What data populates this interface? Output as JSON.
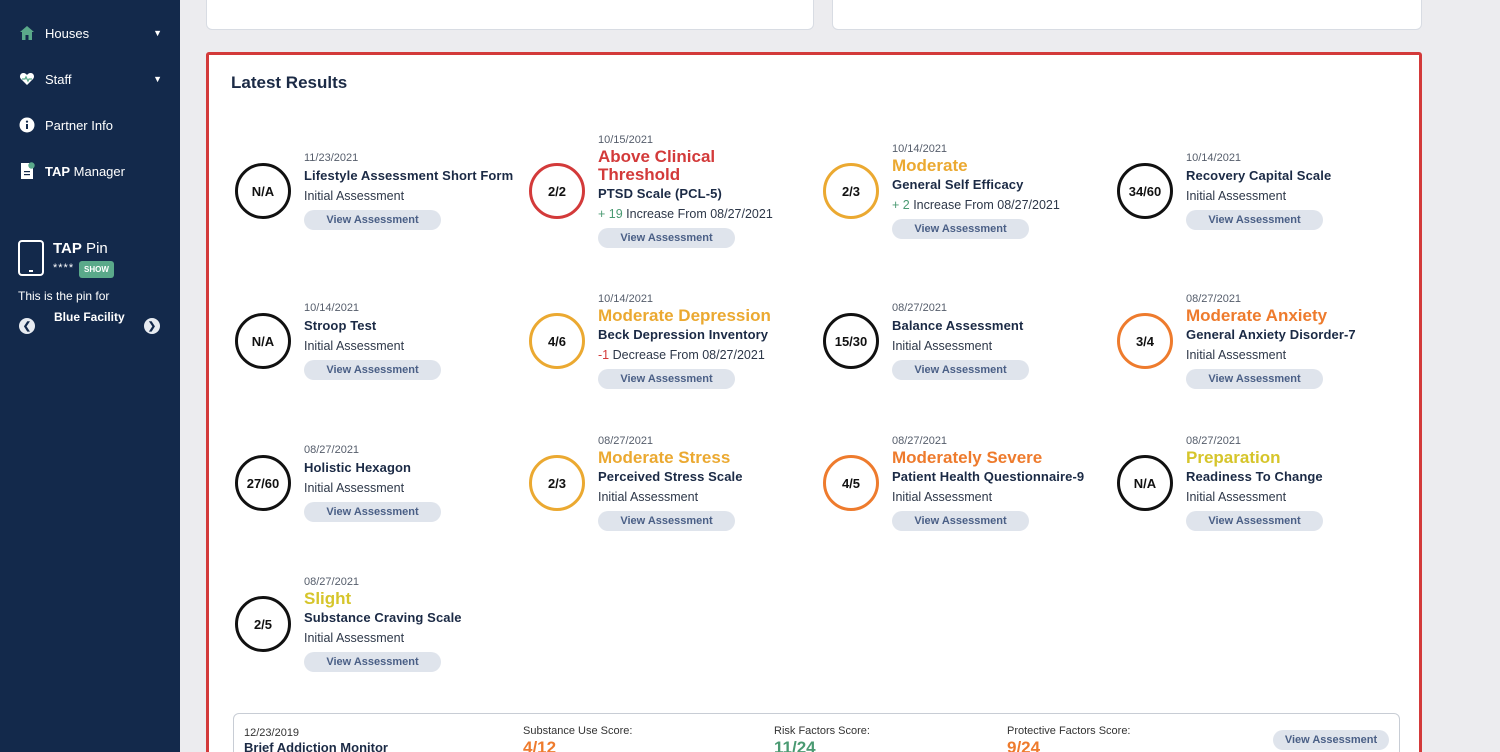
{
  "sidebar": {
    "houses_label": "Houses",
    "staff_label": "Staff",
    "partner_info_label": "Partner Info",
    "tap_manager_bold": "TAP",
    "tap_manager_rest": " Manager",
    "tap_pin_bold": "TAP",
    "tap_pin_rest": " Pin",
    "pin_masked": "****",
    "show_label": "SHOW",
    "pin_for_text": "This is the pin for",
    "facility_name": "Blue Facility"
  },
  "results": {
    "title": "Latest Results",
    "view_label": "View Assessment",
    "items": [
      {
        "score": "N/A",
        "date": "11/23/2021",
        "severity": "",
        "name": "Lifestyle Assessment Short Form",
        "sub": "Initial Assessment",
        "delta": "",
        "delta_text": ""
      },
      {
        "score": "2/2",
        "date": "10/15/2021",
        "severity": "Above Clinical Threshold",
        "name": "PTSD Scale (PCL-5)",
        "sub": "",
        "delta": "+ 19",
        "delta_text": " Increase From 08/27/2021"
      },
      {
        "score": "2/3",
        "date": "10/14/2021",
        "severity": "Moderate",
        "name": "General Self Efficacy",
        "sub": "",
        "delta": "+ 2",
        "delta_text": " Increase From 08/27/2021"
      },
      {
        "score": "34/60",
        "date": "10/14/2021",
        "severity": "",
        "name": "Recovery Capital Scale",
        "sub": "Initial Assessment",
        "delta": "",
        "delta_text": ""
      },
      {
        "score": "N/A",
        "date": "10/14/2021",
        "severity": "",
        "name": "Stroop Test",
        "sub": "Initial Assessment",
        "delta": "",
        "delta_text": ""
      },
      {
        "score": "4/6",
        "date": "10/14/2021",
        "severity": "Moderate Depression",
        "name": "Beck Depression Inventory",
        "sub": "",
        "delta": "-1",
        "delta_text": " Decrease From 08/27/2021"
      },
      {
        "score": "15/30",
        "date": "08/27/2021",
        "severity": "",
        "name": "Balance Assessment",
        "sub": "Initial Assessment",
        "delta": "",
        "delta_text": ""
      },
      {
        "score": "3/4",
        "date": "08/27/2021",
        "severity": "Moderate Anxiety",
        "name": "General Anxiety Disorder-7",
        "sub": "Initial Assessment",
        "delta": "",
        "delta_text": ""
      },
      {
        "score": "27/60",
        "date": "08/27/2021",
        "severity": "",
        "name": "Holistic Hexagon",
        "sub": "Initial Assessment",
        "delta": "",
        "delta_text": ""
      },
      {
        "score": "2/3",
        "date": "08/27/2021",
        "severity": "Moderate Stress",
        "name": "Perceived Stress Scale",
        "sub": "Initial Assessment",
        "delta": "",
        "delta_text": ""
      },
      {
        "score": "4/5",
        "date": "08/27/2021",
        "severity": "Moderately Severe",
        "name": "Patient Health Questionnaire-9",
        "sub": "Initial Assessment",
        "delta": "",
        "delta_text": ""
      },
      {
        "score": "N/A",
        "date": "08/27/2021",
        "severity": "Preparation",
        "name": "Readiness To Change",
        "sub": "Initial Assessment",
        "delta": "",
        "delta_text": ""
      },
      {
        "score": "2/5",
        "date": "08/27/2021",
        "severity": "Slight",
        "name": "Substance Craving Scale",
        "sub": "Initial Assessment",
        "delta": "",
        "delta_text": ""
      }
    ]
  },
  "colors": {
    "red": "#d33a3a",
    "amber": "#eba931",
    "orange": "#ee7b2d",
    "yellow": "#d6c52b",
    "green": "#4a9a72",
    "black": "#111111"
  },
  "bam": {
    "date": "12/23/2019",
    "name": "Brief Addiction Monitor",
    "substance_label": "Substance Use Score:",
    "substance_value": "4/12",
    "risk_label": "Risk Factors Score:",
    "risk_value": "11/24",
    "protective_label": "Protective Factors Score:",
    "protective_value": "9/24",
    "view_label": "View Assessment"
  }
}
